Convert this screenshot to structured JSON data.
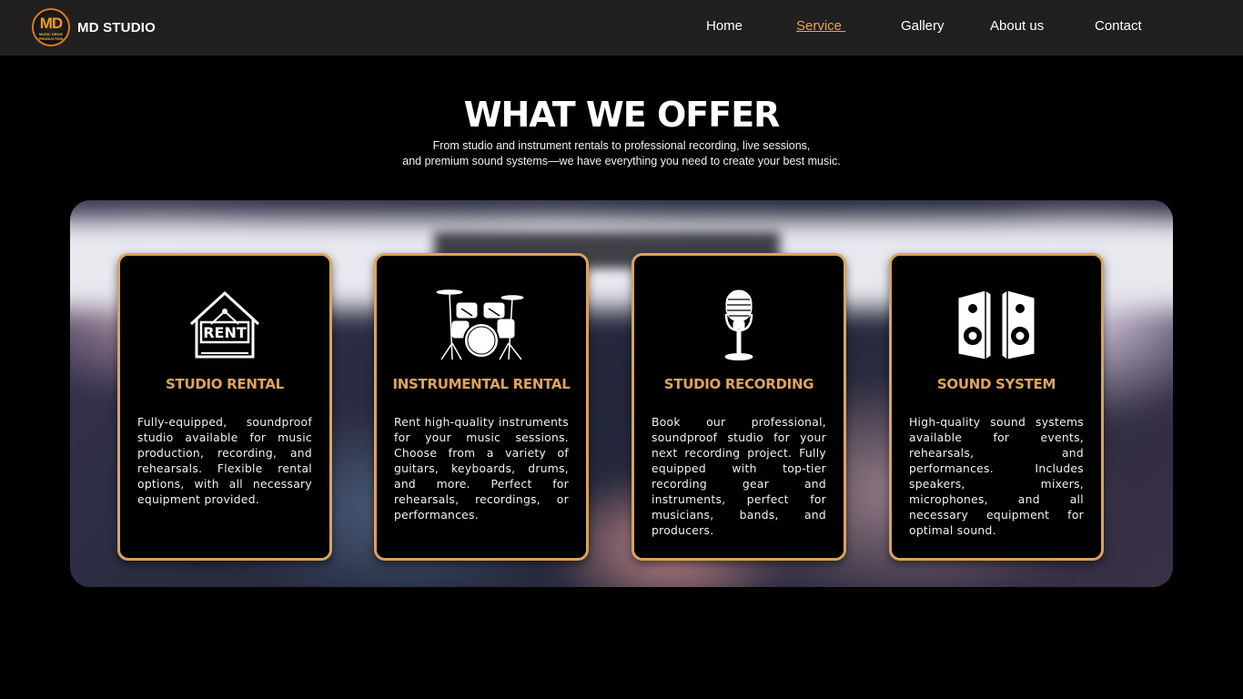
{
  "nav": {
    "brand": "MD STUDIO",
    "logo_mark": "MD",
    "logo_sub": "MUSIC DRIVE PRODUCTION",
    "items": [
      {
        "label": "Home"
      },
      {
        "label": "Service ",
        "active": true
      },
      {
        "label": "Gallery"
      },
      {
        "label": "About us"
      },
      {
        "label": "Contact"
      }
    ]
  },
  "hero": {
    "title": "WHAT WE OFFER",
    "subtitle_line1": "From studio and instrument rentals to professional recording, live sessions,",
    "subtitle_line2": "and premium sound systems—we have everything you need to create your best music."
  },
  "cards": [
    {
      "icon": "rent-house-icon",
      "title": "STUDIO RENTAL",
      "text": "  Fully-equipped, soundproof studio available for music production, recording, and rehearsals. Flexible rental options, with all necessary equipment provided."
    },
    {
      "icon": "drum-kit-icon",
      "title": "INSTRUMENTAL RENTAL",
      "text": "        Rent high-quality instruments for your music sessions. Choose from a variety of guitars, keyboards, drums, and more. Perfect for rehearsals, recordings, or performances."
    },
    {
      "icon": "microphone-icon",
      "title": "STUDIO RECORDING",
      "text": "   Book our professional, soundproof studio for your next recording project. Fully equipped with top-tier recording gear and instruments, perfect for musicians, bands, and producers."
    },
    {
      "icon": "speakers-icon",
      "title": "SOUND SYSTEM",
      "text": "High-quality sound systems available for events, rehearsals, and performances. Includes speakers, mixers, microphones, and all necessary equipment for optimal sound."
    }
  ],
  "colors": {
    "accent": "#e0a35c",
    "card_border": "#d9a45c",
    "nav_bg": "#221f20",
    "page_bg": "#000000"
  }
}
